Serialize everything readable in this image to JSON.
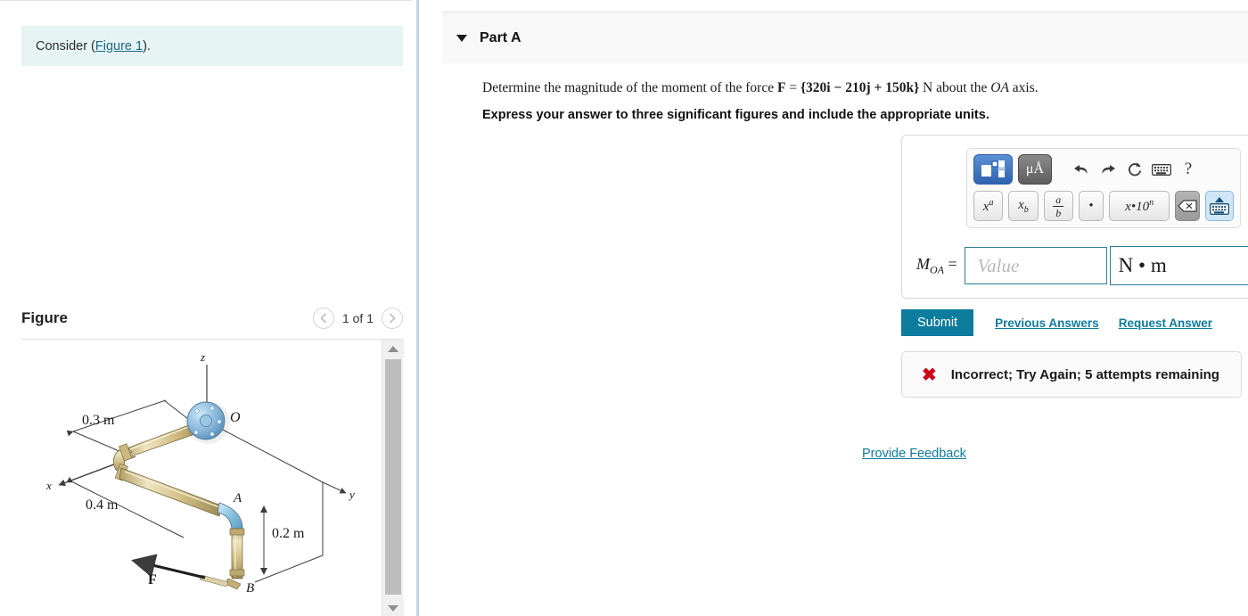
{
  "left": {
    "consider": {
      "prefix": "Consider (",
      "link": "Figure 1",
      "suffix": ")."
    },
    "figure": {
      "title": "Figure",
      "count_label": "1 of 1",
      "prev_icon": "chevron-left-icon",
      "next_icon": "chevron-right-icon",
      "diagram": {
        "labels": {
          "z": "z",
          "x": "x",
          "y": "y",
          "O": "O",
          "A": "A",
          "B": "B",
          "F": "F",
          "d1": "0.3 m",
          "d2": "0.4 m",
          "d3": "0.2 m"
        },
        "colors": {
          "pipe": "#cdb87f",
          "pipe_light": "#e5d9ae",
          "pipe_dark": "#9c8b55",
          "flange": "#7fb1d4",
          "elbow_blue": "#8cc2e0",
          "line": "#3c3c3c"
        }
      },
      "scrollbar": {
        "up_icon": "scroll-up-arrow-icon",
        "down_icon": "scroll-down-arrow-icon"
      }
    }
  },
  "right": {
    "part_header": {
      "caret_icon": "caret-down-icon",
      "title": "Part A"
    },
    "question": {
      "line1_a": "Determine the magnitude of the moment of the force ",
      "force_symbol": "F",
      "equals": " = ",
      "force_value": "{320i − 210j + 150k}",
      "unit": " N",
      "line1_b": " about the ",
      "axis": "OA",
      "line1_c": " axis.",
      "instruction": "Express your answer to three significant figures and include the appropriate units."
    },
    "toolbar": {
      "template_button": {
        "icon": "math-template-icon",
        "label": ""
      },
      "units_button": {
        "icon": "micro-angstrom-icon",
        "label": "μÅ"
      },
      "undo": {
        "icon": "undo-arrow-icon",
        "label": "↰"
      },
      "redo": {
        "icon": "redo-arrow-icon",
        "label": "↱"
      },
      "reset": {
        "icon": "reset-circular-arrow-icon",
        "label": "↻"
      },
      "keyboard": {
        "icon": "keyboard-icon",
        "label": "⌨"
      },
      "help": {
        "icon": "question-mark-icon",
        "label": "?"
      },
      "superscript": {
        "icon": "x-superscript-a-icon",
        "base": "x",
        "sup": "a"
      },
      "subscript": {
        "icon": "x-subscript-b-icon",
        "base": "x",
        "sub": "b"
      },
      "fraction": {
        "icon": "fraction-a-over-b-icon",
        "num": "a",
        "den": "b"
      },
      "dot": {
        "icon": "dot-product-icon",
        "label": "•"
      },
      "scientific": {
        "icon": "scientific-notation-icon",
        "label_a": "x",
        "label_b": "•10",
        "label_c": "n"
      },
      "backspace": {
        "icon": "backspace-icon",
        "label": "⌫"
      },
      "toggle_keyboard": {
        "icon": "keyboard-collapse-icon",
        "label": "⌨"
      }
    },
    "answer": {
      "symbol": "M",
      "symbol_sub": "OA",
      "equals": "=",
      "value_placeholder": "Value",
      "units": "N • m"
    },
    "actions": {
      "submit": "Submit",
      "previous_answers": "Previous Answers",
      "request_answer": "Request Answer"
    },
    "feedback": {
      "status_icon": "x-error-icon",
      "status_glyph": "✖",
      "message": "Incorrect; Try Again; 5 attempts remaining"
    },
    "provide_feedback": "Provide Feedback"
  },
  "colors": {
    "accent_teal": "#0d7c9e",
    "info_bg": "#e6f4f3",
    "error_red": "#d0011b",
    "header_bg": "#f8f8f8",
    "divider": "#c3d5e3"
  }
}
